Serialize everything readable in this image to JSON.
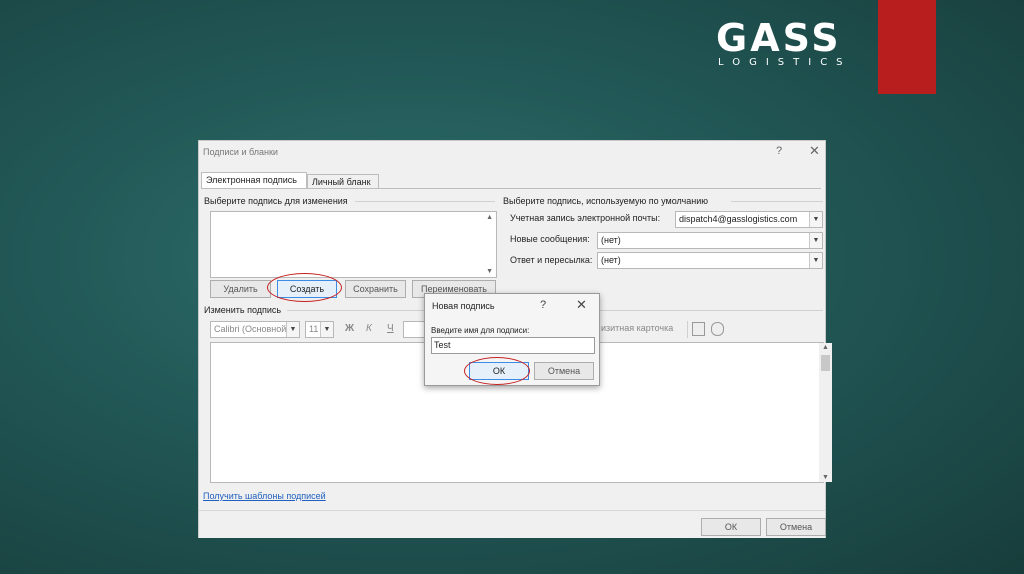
{
  "logo": {
    "main": "GASS",
    "sub": "LOGISTICS"
  },
  "colors": {
    "brand_red": "#b81e1e",
    "background": "#215756",
    "highlight_ring": "#c62020"
  },
  "dialog": {
    "title": "Подписи и бланки",
    "help": "?",
    "close": "✕",
    "tabs": [
      "Электронная подпись",
      "Личный бланк"
    ],
    "select_section": "Выберите подпись для изменения",
    "default_section": "Выберите подпись, используемую по умолчанию",
    "buttons": {
      "delete": "Удалить",
      "create": "Создать",
      "save": "Сохранить",
      "rename": "Переименовать"
    },
    "account_label": "Учетная запись электронной почты:",
    "account_value": "dispatch4@gasslogistics.com",
    "new_messages_label": "Новые сообщения:",
    "new_messages_value": "(нет)",
    "reply_label": "Ответ и пересылка:",
    "reply_value": "(нет)",
    "edit_section": "Изменить подпись",
    "font_value": "Calibri (Основной",
    "size_value": "11",
    "bold": "Ж",
    "italic": "К",
    "underline": "Ч",
    "business_card": "изитная карточка",
    "templates_link": "Получить шаблоны подписей",
    "ok": "ОК",
    "cancel": "Отмена"
  },
  "modal": {
    "title": "Новая подпись",
    "help": "?",
    "close": "✕",
    "label": "Введите имя для подписи:",
    "value": "Test",
    "ok": "ОК",
    "cancel": "Отмена"
  }
}
